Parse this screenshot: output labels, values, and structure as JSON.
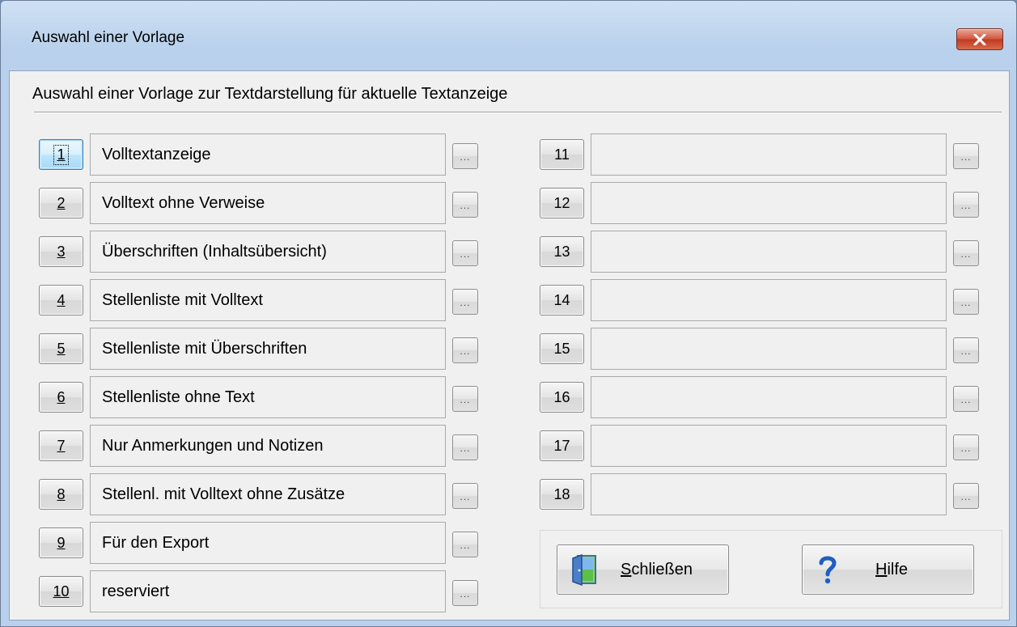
{
  "window": {
    "title": "Auswahl einer Vorlage",
    "close_icon": "close-x-icon"
  },
  "header": {
    "text": "Auswahl einer Vorlage zur Textdarstellung für aktuelle Textanzeige"
  },
  "templates_left": [
    {
      "number": "1",
      "label": "Volltextanzeige",
      "focused": true
    },
    {
      "number": "2",
      "label": "Volltext ohne Verweise"
    },
    {
      "number": "3",
      "label": "Überschriften (Inhaltsübersicht)"
    },
    {
      "number": "4",
      "label": "Stellenliste mit Volltext"
    },
    {
      "number": "5",
      "label": "Stellenliste mit Überschriften"
    },
    {
      "number": "6",
      "label": "Stellenliste ohne Text"
    },
    {
      "number": "7",
      "label": "Nur Anmerkungen und Notizen"
    },
    {
      "number": "8",
      "label": "Stellenl. mit Volltext ohne Zusätze"
    },
    {
      "number": "9",
      "label": "Für den Export"
    },
    {
      "number": "10",
      "label": "reserviert"
    }
  ],
  "templates_right": [
    {
      "number": "11",
      "label": ""
    },
    {
      "number": "12",
      "label": ""
    },
    {
      "number": "13",
      "label": ""
    },
    {
      "number": "14",
      "label": ""
    },
    {
      "number": "15",
      "label": ""
    },
    {
      "number": "16",
      "label": ""
    },
    {
      "number": "17",
      "label": ""
    },
    {
      "number": "18",
      "label": ""
    }
  ],
  "browse_button_label": "...",
  "actions": {
    "close": {
      "prefix": "",
      "accel": "S",
      "rest": "chließen",
      "icon": "door-exit-icon"
    },
    "help": {
      "prefix": "",
      "accel": "H",
      "rest": "ilfe",
      "icon": "question-mark-icon"
    }
  },
  "colors": {
    "window_frame": "#b9d1ec",
    "client_bg": "#f0f0f0",
    "close_button": "#c03a20",
    "help_icon": "#1f5fbf"
  }
}
